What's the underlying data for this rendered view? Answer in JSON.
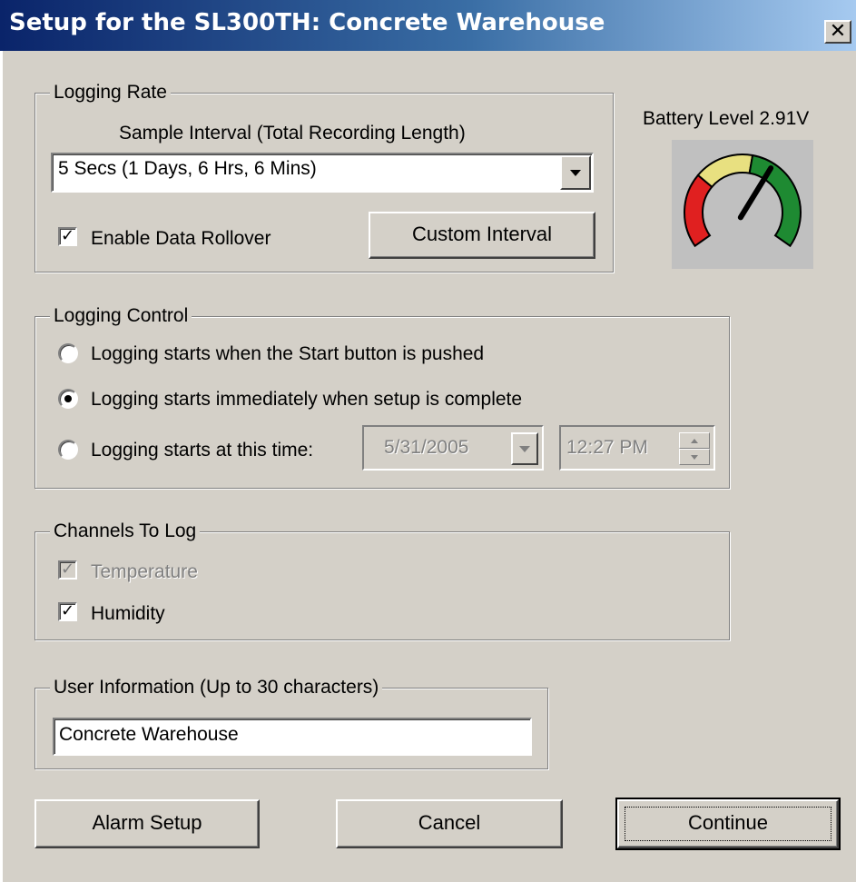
{
  "window": {
    "title": "Setup for the SL300TH:  Concrete Warehouse",
    "close_glyph": "✕"
  },
  "logging_rate": {
    "legend": "Logging Rate",
    "sample_label": "Sample Interval  (Total Recording Length)",
    "sample_value": "5 Secs  (1 Days, 6 Hrs, 6 Mins)",
    "rollover_label": "Enable Data Rollover",
    "rollover_checked": true,
    "custom_interval_label": "Custom Interval"
  },
  "battery": {
    "label": "Battery Level 2.91V",
    "level_fraction": 0.63,
    "colors": {
      "low": "#e02020",
      "mid": "#e8e080",
      "high": "#1e8a32"
    }
  },
  "logging_control": {
    "legend": "Logging Control",
    "options": [
      {
        "label": "Logging starts when the Start button is pushed",
        "selected": false
      },
      {
        "label": "Logging starts immediately when setup is complete",
        "selected": true
      },
      {
        "label": "Logging starts at this time:",
        "selected": false
      }
    ],
    "date_value": "5/31/2005",
    "time_value": "12:27 PM"
  },
  "channels": {
    "legend": "Channels To Log",
    "items": [
      {
        "label": "Temperature",
        "checked": true,
        "disabled": true
      },
      {
        "label": "Humidity",
        "checked": true,
        "disabled": false
      }
    ]
  },
  "user_info": {
    "legend": "User Information (Up to 30 characters)",
    "value": "Concrete Warehouse"
  },
  "buttons": {
    "alarm_setup": "Alarm Setup",
    "cancel": "Cancel",
    "continue": "Continue"
  }
}
